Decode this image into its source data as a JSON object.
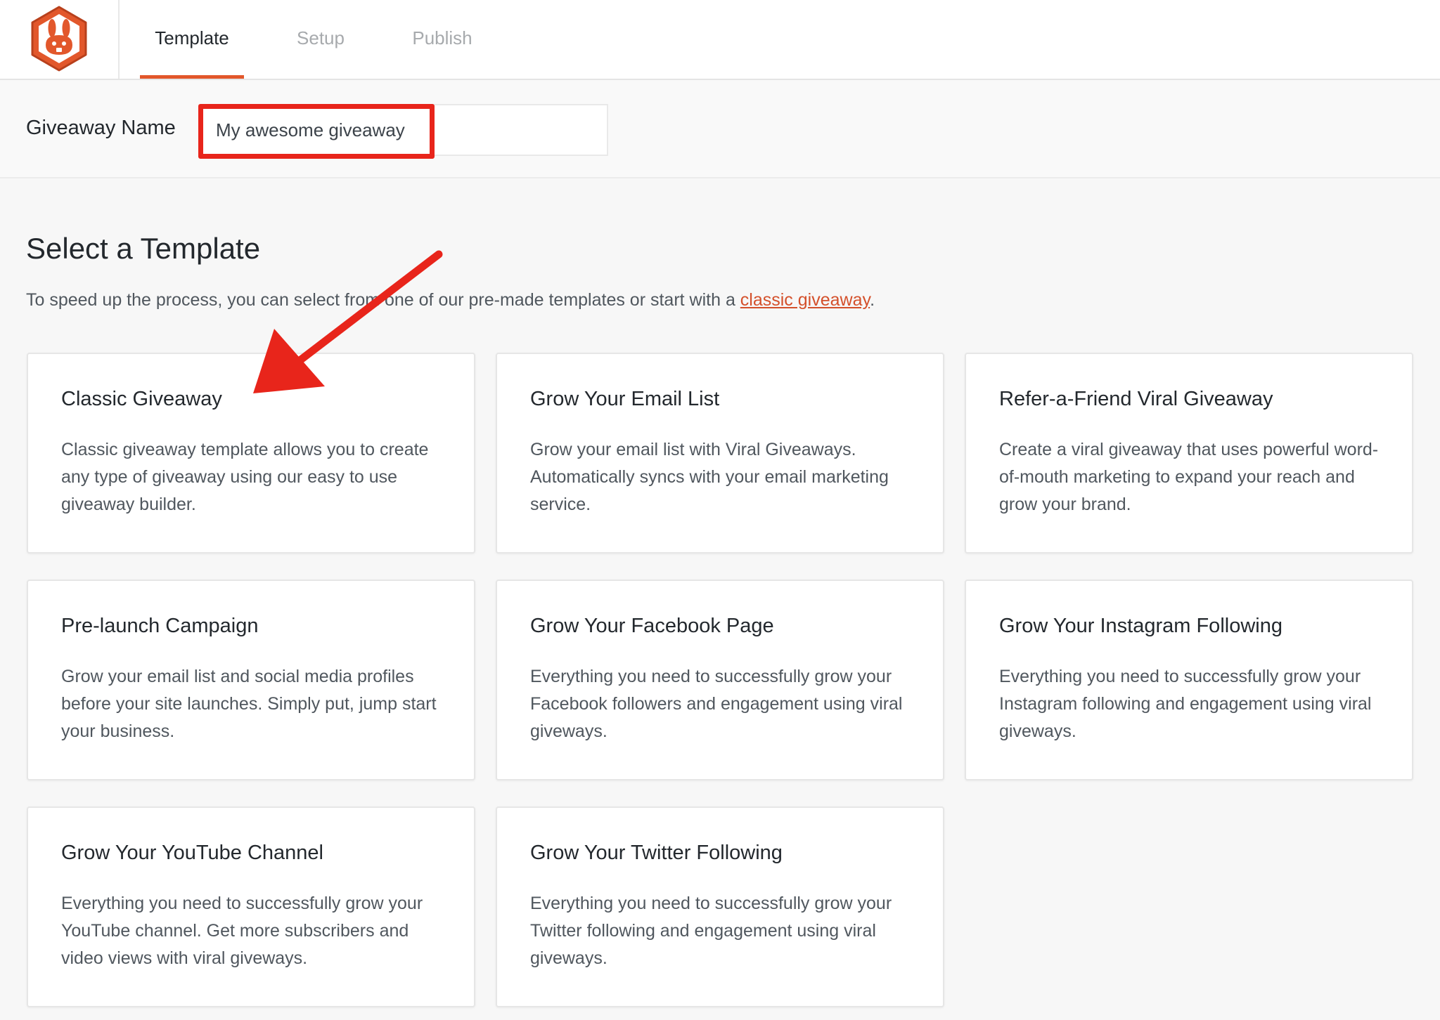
{
  "tabs": [
    {
      "label": "Template",
      "active": true
    },
    {
      "label": "Setup",
      "active": false
    },
    {
      "label": "Publish",
      "active": false
    }
  ],
  "giveaway_name": {
    "label": "Giveaway Name",
    "value": "My awesome giveaway"
  },
  "section": {
    "title": "Select a Template",
    "desc_before": "To speed up the process, you can select from one of our pre-made templates or start with a ",
    "desc_link": "classic giveaway",
    "desc_after": "."
  },
  "templates": [
    {
      "title": "Classic Giveaway",
      "desc": "Classic giveaway template allows you to create any type of giveaway using our easy to use giveaway builder."
    },
    {
      "title": "Grow Your Email List",
      "desc": "Grow your email list with Viral Giveaways. Automatically syncs with your email marketing service."
    },
    {
      "title": "Refer-a-Friend Viral Giveaway",
      "desc": "Create a viral giveaway that uses powerful word-of-mouth marketing to expand your reach and grow your brand."
    },
    {
      "title": "Pre-launch Campaign",
      "desc": "Grow your email list and social media profiles before your site launches. Simply put, jump start your business."
    },
    {
      "title": "Grow Your Facebook Page",
      "desc": "Everything you need to successfully grow your Facebook followers and engagement using viral giveways."
    },
    {
      "title": "Grow Your Instagram Following",
      "desc": "Everything you need to successfully grow your Instagram following and engagement using viral giveways."
    },
    {
      "title": "Grow Your YouTube Channel",
      "desc": "Everything you need to successfully grow your YouTube channel. Get more subscribers and video views with viral giveways."
    },
    {
      "title": "Grow Your Twitter Following",
      "desc": "Everything you need to successfully grow your Twitter following and engagement using viral giveways."
    }
  ],
  "icons": {
    "logo": "rabbit-hexagon-logo",
    "annotation_arrow": "red-arrow-icon"
  },
  "colors": {
    "brand": "#e2572b",
    "link": "#d4502b",
    "annotation": "#e8251b"
  }
}
